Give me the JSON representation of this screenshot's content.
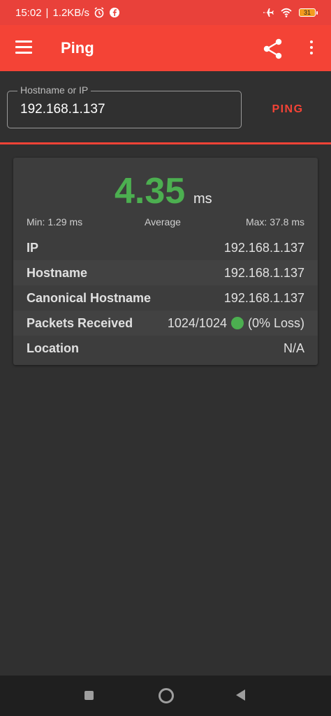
{
  "status_bar": {
    "time": "15:02",
    "separator": "|",
    "net_speed": "1.2KB/s",
    "battery_level": "31",
    "icons": [
      "alarm-icon",
      "facebook-icon",
      "airplane-icon",
      "wifi-icon",
      "battery-icon"
    ]
  },
  "app_bar": {
    "title": "Ping",
    "icons": [
      "menu-icon",
      "share-icon",
      "more-vert-icon"
    ]
  },
  "input": {
    "label": "Hostname or IP",
    "value": "192.168.1.137",
    "button_label": "PING"
  },
  "result": {
    "average_value": "4.35",
    "average_unit": "ms",
    "min_text": "Min: 1.29 ms",
    "average_label": "Average",
    "max_text": "Max: 37.8 ms",
    "rows": [
      {
        "key": "IP",
        "value": "192.168.1.137"
      },
      {
        "key": "Hostname",
        "value": "192.168.1.137"
      },
      {
        "key": "Canonical Hostname",
        "value": "192.168.1.137"
      },
      {
        "key": "Packets Received",
        "value": "1024/1024",
        "suffix": "(0% Loss)"
      },
      {
        "key": "Location",
        "value": "N/A"
      }
    ]
  },
  "colors": {
    "accent": "#f44336",
    "status_bar": "#e9413a",
    "success": "#4caf50",
    "background": "#303030",
    "card": "#3d3d3d"
  }
}
